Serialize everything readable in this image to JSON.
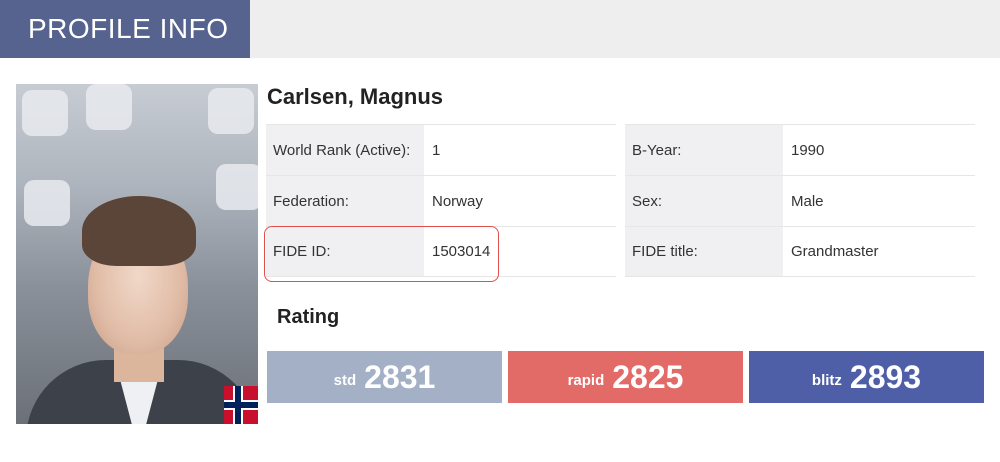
{
  "header": {
    "title": "PROFILE INFO",
    "tab_color": "#56638f"
  },
  "player": {
    "name": "Carlsen, Magnus",
    "photo": "player-photo",
    "flag": "norway-flag-icon"
  },
  "details_left": [
    {
      "label": "World Rank (Active):",
      "value": "1"
    },
    {
      "label": "Federation:",
      "value": "Norway"
    },
    {
      "label": "FIDE ID:",
      "value": "1503014"
    }
  ],
  "details_right": [
    {
      "label": "B-Year:",
      "value": "1990"
    },
    {
      "label": "Sex:",
      "value": "Male"
    },
    {
      "label": "FIDE title:",
      "value": "Grandmaster"
    }
  ],
  "rating": {
    "title": "Rating",
    "std": {
      "label": "std",
      "value": "2831",
      "color": "#a4b0c6"
    },
    "rapid": {
      "label": "rapid",
      "value": "2825",
      "color": "#e26a67"
    },
    "blitz": {
      "label": "blitz",
      "value": "2893",
      "color": "#4e5fa8"
    }
  },
  "highlight_color": "#e0504a"
}
